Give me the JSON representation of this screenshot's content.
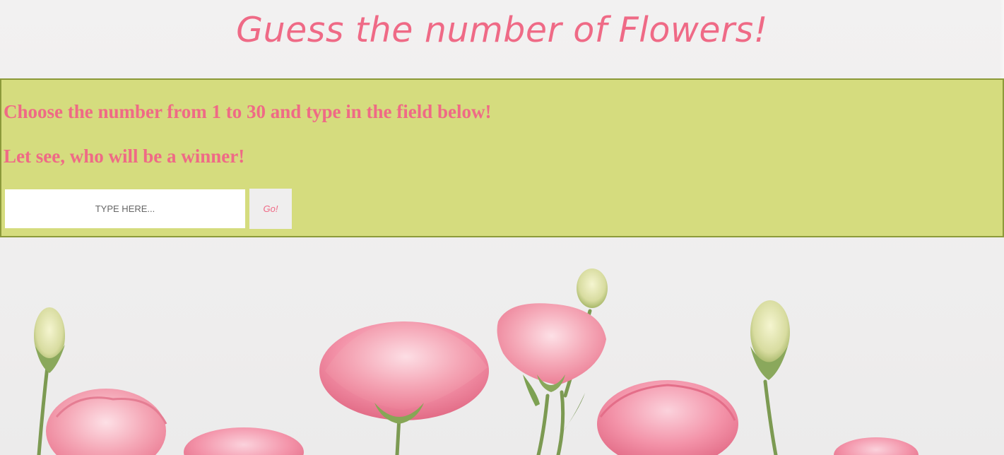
{
  "header": {
    "title": "Guess the number of Flowers!"
  },
  "panel": {
    "instruction": "Choose the number from 1 to 30 and type in the field below!",
    "subtext": "Let see, who will be a winner!",
    "input": {
      "placeholder": "TYPE HERE...",
      "value": ""
    },
    "submit_label": "Go!"
  },
  "colors": {
    "accent": "#ef6a86",
    "panel_bg": "#d5dc7e",
    "panel_border": "#8c9a3a",
    "page_bg": "#f0efef"
  },
  "decoration": {
    "image": "pink-eustoma-flowers-photo"
  }
}
